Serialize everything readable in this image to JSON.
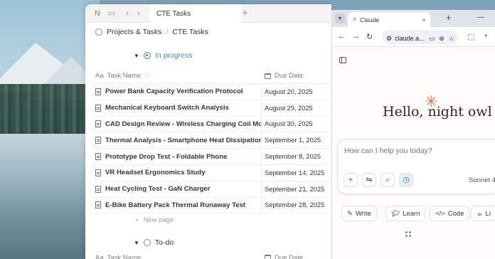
{
  "notion": {
    "tab_title": "CTE Tasks",
    "breadcrumb": [
      "Projects & Tasks",
      "CTE Tasks"
    ],
    "group_in_progress": "In progress",
    "group_todo": "To-do",
    "columns": {
      "name": "Task Name",
      "due": "Due Date"
    },
    "rows": [
      {
        "name": "Power Bank Capacity Verification Protocol",
        "due": "August 20, 2025"
      },
      {
        "name": "Mechanical Keyboard Switch Analysis",
        "due": "August 29, 2025"
      },
      {
        "name": "CAD Design Review - Wireless Charging Coil Mount",
        "due": "August 30, 2025"
      },
      {
        "name": "Thermal Analysis - Smartphone Heat Dissipation",
        "due": "September 1, 2025"
      },
      {
        "name": "Prototype Drop Test - Foldable Phone",
        "due": "September 8, 2025"
      },
      {
        "name": "VR Headset Ergonomics Study",
        "due": "September 14, 2025"
      },
      {
        "name": "Heat Cycling Test - GaN Charger",
        "due": "September 21, 2025"
      },
      {
        "name": "E-Bike Battery Pack Thermal Runaway Test",
        "due": "September 28, 2025"
      }
    ],
    "new_page": "New page"
  },
  "browser": {
    "tab_title": "Claude",
    "url": "claude.a..."
  },
  "claude": {
    "greeting": "Hello, night owl",
    "placeholder": "How can I help you today?",
    "model": "Sonnet 4 ·",
    "chips": [
      "Write",
      "Learn",
      "Code",
      "Li"
    ]
  },
  "colors": {
    "accent": "#d97757",
    "notion_blue": "#4a7fb5"
  }
}
